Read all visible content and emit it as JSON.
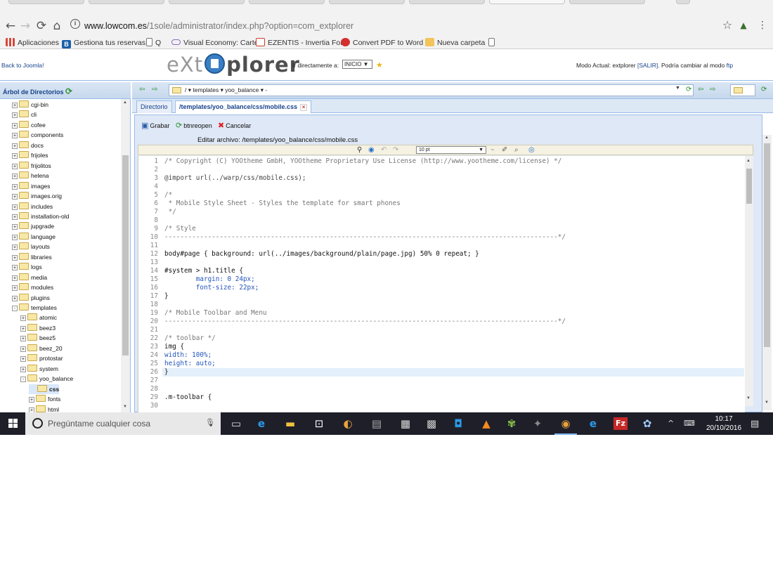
{
  "browser": {
    "url_host": "www.lowcom.es",
    "url_path": "/1sole/administrator/index.php?option=com_extplorer",
    "bookmarks": [
      {
        "label": "Aplicaciones",
        "color": "#d8453b"
      },
      {
        "label": "Gestiona tus reservas",
        "color": "#1b5fa8"
      },
      {
        "label": "Q",
        "color": "#ffffff"
      },
      {
        "label": "Visual Economy: Carte",
        "color": "#8c67c2"
      },
      {
        "label": "EZENTIS - Invertia For",
        "color": "#d33b2c"
      },
      {
        "label": "Convert PDF to Word",
        "color": "#d32f2f"
      },
      {
        "label": "Nueva carpeta",
        "color": "#f2c45a"
      }
    ]
  },
  "app": {
    "back_link": "Back to Joomla!",
    "logo_left": "eXt",
    "logo_right": "plorer",
    "goto_label": "Ir directamente a:",
    "goto_value": "INICIO",
    "mode_prefix": "Modo Actual: extplorer",
    "mode_salir": "[SALIR]",
    "mode_middle": ". Podría cambiar al modo",
    "mode_ftp": "ftp"
  },
  "tree": {
    "title": "Árbol de Directorios",
    "items": [
      {
        "label": "cgi-bin",
        "indent": 0,
        "sign": "+"
      },
      {
        "label": "cli",
        "indent": 0,
        "sign": "+"
      },
      {
        "label": "cofee",
        "indent": 0,
        "sign": "+"
      },
      {
        "label": "components",
        "indent": 0,
        "sign": "+"
      },
      {
        "label": "docs",
        "indent": 0,
        "sign": "+"
      },
      {
        "label": "frijoles",
        "indent": 0,
        "sign": "+"
      },
      {
        "label": "frijolitos",
        "indent": 0,
        "sign": "+"
      },
      {
        "label": "helena",
        "indent": 0,
        "sign": "+"
      },
      {
        "label": "images",
        "indent": 0,
        "sign": "+"
      },
      {
        "label": "images.orig",
        "indent": 0,
        "sign": "+"
      },
      {
        "label": "includes",
        "indent": 0,
        "sign": "+"
      },
      {
        "label": "installation-old",
        "indent": 0,
        "sign": "+"
      },
      {
        "label": "jupgrade",
        "indent": 0,
        "sign": "+"
      },
      {
        "label": "language",
        "indent": 0,
        "sign": "+"
      },
      {
        "label": "layouts",
        "indent": 0,
        "sign": "+"
      },
      {
        "label": "libraries",
        "indent": 0,
        "sign": "+"
      },
      {
        "label": "logs",
        "indent": 0,
        "sign": "+"
      },
      {
        "label": "media",
        "indent": 0,
        "sign": "+"
      },
      {
        "label": "modules",
        "indent": 0,
        "sign": "+"
      },
      {
        "label": "plugins",
        "indent": 0,
        "sign": "+"
      },
      {
        "label": "templates",
        "indent": 0,
        "sign": "-"
      },
      {
        "label": "atomic",
        "indent": 1,
        "sign": "+"
      },
      {
        "label": "beez3",
        "indent": 1,
        "sign": "+"
      },
      {
        "label": "beez5",
        "indent": 1,
        "sign": "+"
      },
      {
        "label": "beez_20",
        "indent": 1,
        "sign": "+"
      },
      {
        "label": "protostar",
        "indent": 1,
        "sign": "+"
      },
      {
        "label": "system",
        "indent": 1,
        "sign": "+"
      },
      {
        "label": "yoo_balance",
        "indent": 1,
        "sign": "-"
      },
      {
        "label": "css",
        "indent": 2,
        "sign": "",
        "selected": true
      },
      {
        "label": "fonts",
        "indent": 2,
        "sign": "+"
      },
      {
        "label": "html",
        "indent": 2,
        "sign": "+"
      }
    ]
  },
  "path": {
    "value": "/ ▾ templates ▾ yoo_balance ▾ -"
  },
  "tabs": [
    {
      "label": "Directorio",
      "active": false
    },
    {
      "label": "/templates/yoo_balance/css/mobile.css",
      "active": true
    }
  ],
  "editor": {
    "save": "Grabar",
    "reopen": "btnreopen",
    "cancel": "Cancelar",
    "editing_label": "Editar archivo: /templates/yoo_balance/css/mobile.css",
    "font_size": "10 pt",
    "lines": [
      "/* Copyright (C) YOOtheme GmbH, YOOtheme Proprietary Use License (http://www.yootheme.com/license) */",
      "",
      "@import url(../warp/css/mobile.css);",
      "",
      "/*",
      " * Mobile Style Sheet - Styles the template for smart phones",
      " */",
      "",
      "/* Style",
      "----------------------------------------------------------------------------------------------------*/",
      "",
      "body#page { background: url(../images/background/plain/page.jpg) 50% 0 repeat; }",
      "",
      "#system > h1.title {",
      "        margin: 0 24px;",
      "        font-size: 22px;",
      "}",
      "",
      "/* Mobile Toolbar and Menu",
      "----------------------------------------------------------------------------------------------------*/",
      "",
      "/* toolbar */",
      "img {",
      "width: 100%;",
      "height: auto;",
      "}",
      "",
      "",
      ".m-toolbar {",
      ""
    ]
  },
  "taskbar": {
    "search_placeholder": "Pregúntame cualquier cosa",
    "time": "10:17",
    "date": "20/10/2016"
  }
}
